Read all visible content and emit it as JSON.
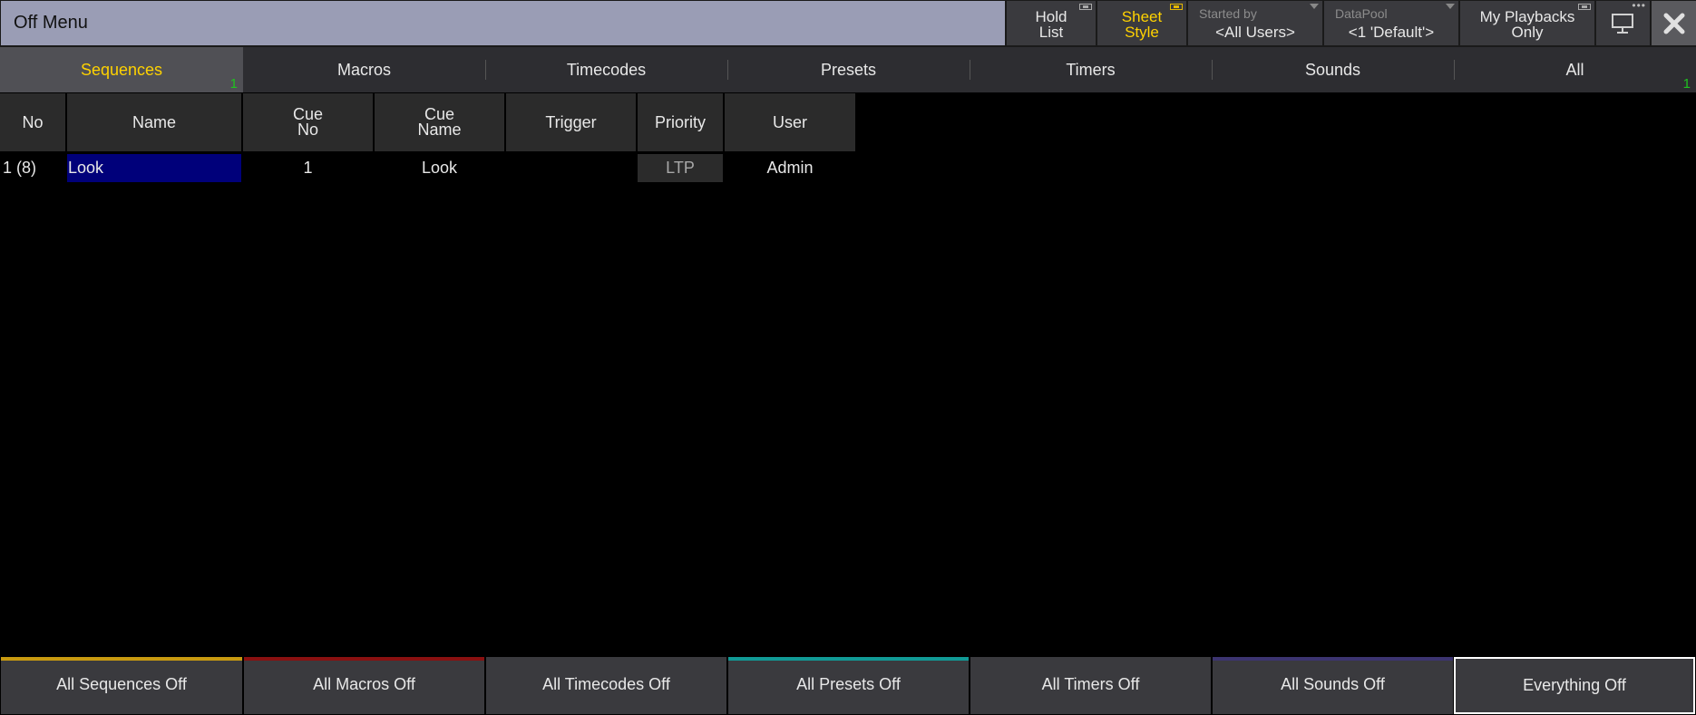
{
  "window": {
    "title": "Off Menu",
    "hold_list": [
      "Hold",
      "List"
    ],
    "sheet_style": [
      "Sheet",
      "Style"
    ],
    "started_by": {
      "label": "Started by",
      "value": "<All Users>"
    },
    "datapool": {
      "label": "DataPool",
      "value": "<1 'Default'>"
    },
    "my_playbacks": [
      "My Playbacks",
      "Only"
    ],
    "accent_color": "#ffd200",
    "title_bg": "#9a9db5"
  },
  "tabs": [
    {
      "label": "Sequences",
      "count": "1",
      "active": true
    },
    {
      "label": "Macros"
    },
    {
      "label": "Timecodes"
    },
    {
      "label": "Presets"
    },
    {
      "label": "Timers"
    },
    {
      "label": "Sounds"
    },
    {
      "label": "All",
      "count": "1"
    }
  ],
  "table": {
    "columns": [
      {
        "label": "No"
      },
      {
        "label": "Name"
      },
      {
        "label": "Cue",
        "sub": "No"
      },
      {
        "label": "Cue",
        "sub": "Name"
      },
      {
        "label": "Trigger"
      },
      {
        "label": "Priority"
      },
      {
        "label": "User"
      }
    ],
    "rows": [
      {
        "no": "1 (8)",
        "name": "Look",
        "cue_no": "1",
        "cue_name": "Look",
        "trigger": "",
        "priority": "LTP",
        "user": "Admin"
      }
    ],
    "selected_color": "#00007a"
  },
  "bottom_buttons": [
    {
      "label": "All Sequences Off",
      "color": "#c89a10"
    },
    {
      "label": "All Macros Off",
      "color": "#8a1010"
    },
    {
      "label": "All Timecodes Off",
      "color": "#3a3a3e"
    },
    {
      "label": "All Presets Off",
      "color": "#119a96"
    },
    {
      "label": "All Timers Off",
      "color": "#3a3a3e"
    },
    {
      "label": "All Sounds Off",
      "color": "#3c3470"
    },
    {
      "label": "Everything Off",
      "color": "#ffffff"
    }
  ]
}
